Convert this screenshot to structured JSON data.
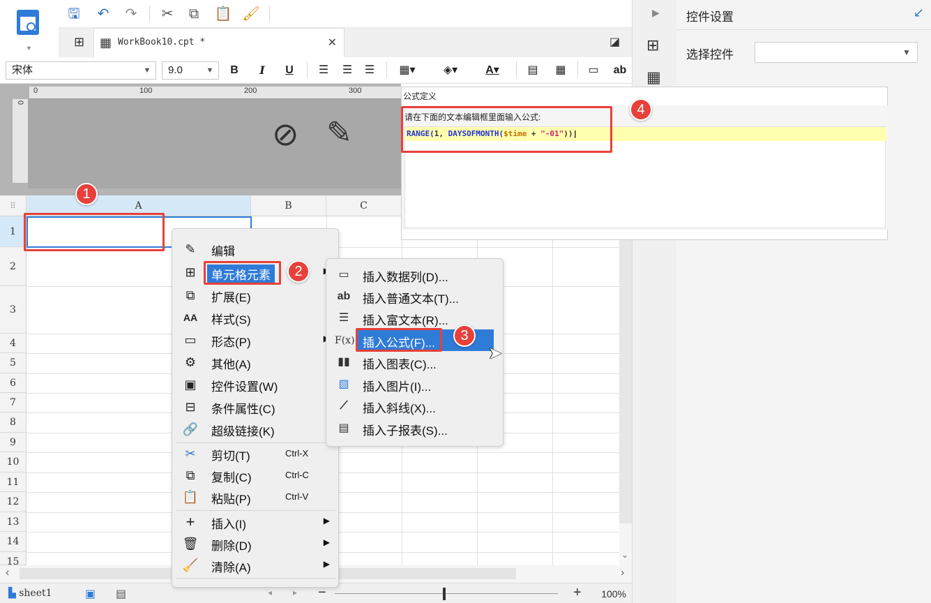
{
  "app": {
    "logo_icon": "report-designer-logo-icon",
    "quick_toolbar": [
      "save-icon",
      "undo-icon",
      "redo-icon",
      "cut-icon",
      "copy-icon",
      "paste-icon",
      "format-painter-icon"
    ],
    "tab": {
      "label": "WorkBook10.cpt *"
    }
  },
  "format_toolbar": {
    "font": "宋体",
    "size": "9.0",
    "bold": "B",
    "italic": "I",
    "underline": "U",
    "text_btn": "ab"
  },
  "ruler": {
    "ticks": [
      "0",
      "100",
      "200",
      "300"
    ],
    "vmark": "0"
  },
  "grid": {
    "columns": [
      "A",
      "B",
      "C"
    ],
    "rows": [
      "1",
      "2",
      "3",
      "4",
      "5",
      "6",
      "7",
      "8",
      "9",
      "10",
      "11",
      "12",
      "13",
      "14",
      "15"
    ]
  },
  "status": {
    "sheet": "sheet1",
    "zoom": "100%",
    "plus": "+"
  },
  "right_panel": {
    "title": "控件设置",
    "select_label": "选择控件",
    "select_value": ""
  },
  "formula_dialog": {
    "title": "公式定义",
    "hint": "请在下面的文本编辑框里面输入公式:",
    "code": {
      "kw1": "RANGE(",
      "arg1": "1, ",
      "kw2": "DAYSOFMONTH(",
      "var": "$time",
      "op": " + ",
      "str": "\"-01\"",
      "close": "))"
    }
  },
  "context_menu": {
    "items": [
      {
        "label": "编辑",
        "icon": "pencil-icon"
      },
      {
        "label": "单元格元素",
        "icon": "cell-element-icon",
        "submenu": true
      },
      {
        "label": "扩展(E)",
        "icon": "expand-icon"
      },
      {
        "label": "样式(S)",
        "icon": "style-icon"
      },
      {
        "label": "形态(P)",
        "icon": "form-icon",
        "submenu": true
      },
      {
        "label": "其他(A)",
        "icon": "gear-icon"
      },
      {
        "label": "控件设置(W)",
        "icon": "widget-icon"
      },
      {
        "label": "条件属性(C)",
        "icon": "condition-icon"
      },
      {
        "label": "超级链接(K)",
        "icon": "link-icon"
      },
      {
        "label": "剪切(T)",
        "icon": "cut-icon",
        "shortcut": "Ctrl-X"
      },
      {
        "label": "复制(C)",
        "icon": "copy-icon",
        "shortcut": "Ctrl-C"
      },
      {
        "label": "粘贴(P)",
        "icon": "paste-icon",
        "shortcut": "Ctrl-V"
      },
      {
        "label": "插入(I)",
        "icon": "plus-icon",
        "submenu": true
      },
      {
        "label": "删除(D)",
        "icon": "trash-icon",
        "submenu": true
      },
      {
        "label": "清除(A)",
        "icon": "eraser-icon",
        "submenu": true
      }
    ]
  },
  "submenu": {
    "items": [
      {
        "label": "插入数据列(D)...",
        "icon": "data-column-icon"
      },
      {
        "label": "插入普通文本(T)...",
        "icon": "text-icon",
        "glyph": "ab"
      },
      {
        "label": "插入富文本(R)...",
        "icon": "rich-text-icon"
      },
      {
        "label": "插入公式(F)...",
        "icon": "formula-icon",
        "glyph": "F(x)"
      },
      {
        "label": "插入图表(C)...",
        "icon": "chart-icon"
      },
      {
        "label": "插入图片(I)...",
        "icon": "image-icon"
      },
      {
        "label": "插入斜线(X)...",
        "icon": "slash-icon"
      },
      {
        "label": "插入子报表(S)...",
        "icon": "subreport-icon"
      }
    ]
  },
  "callouts": [
    "1",
    "2",
    "3",
    "4"
  ],
  "colors": {
    "accent": "#2f7bd8",
    "callout": "#e8403a",
    "formula_line": "#ffffb0"
  }
}
